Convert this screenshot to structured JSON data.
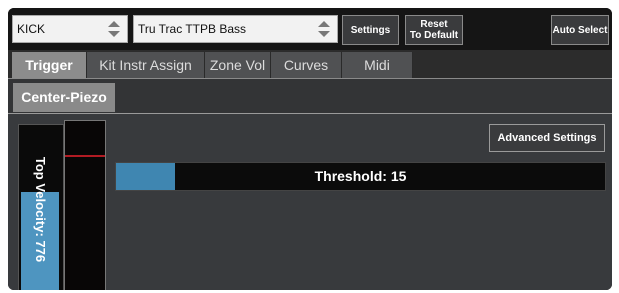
{
  "top_bar": {
    "kit_select_value": "KICK",
    "instrument_select_value": "Tru Trac TTPB Bass",
    "settings_label": "Settings",
    "reset_label_line1": "Reset",
    "reset_label_line2": "To Default",
    "auto_select_label": "Auto Select"
  },
  "tabs": [
    {
      "label": "Trigger",
      "active": true
    },
    {
      "label": "Kit Instr Assign",
      "active": false
    },
    {
      "label": "Zone Vol",
      "active": false
    },
    {
      "label": "Curves",
      "active": false
    },
    {
      "label": "Midi",
      "active": false
    }
  ],
  "subtab": {
    "label": "Center-Piezo"
  },
  "main": {
    "velocity_label": "Top Velocity: 776",
    "velocity_level_percent": 60,
    "hit_marker_percent": 80,
    "advanced_settings_label": "Advanced Settings",
    "threshold_label": "Threshold: 15",
    "threshold_fill_percent": 12
  },
  "colors": {
    "accent_blue": "#4e95c0",
    "marker_red": "#b21b23",
    "tab_active": "#8c8c8c",
    "tab_inactive": "#505153"
  }
}
